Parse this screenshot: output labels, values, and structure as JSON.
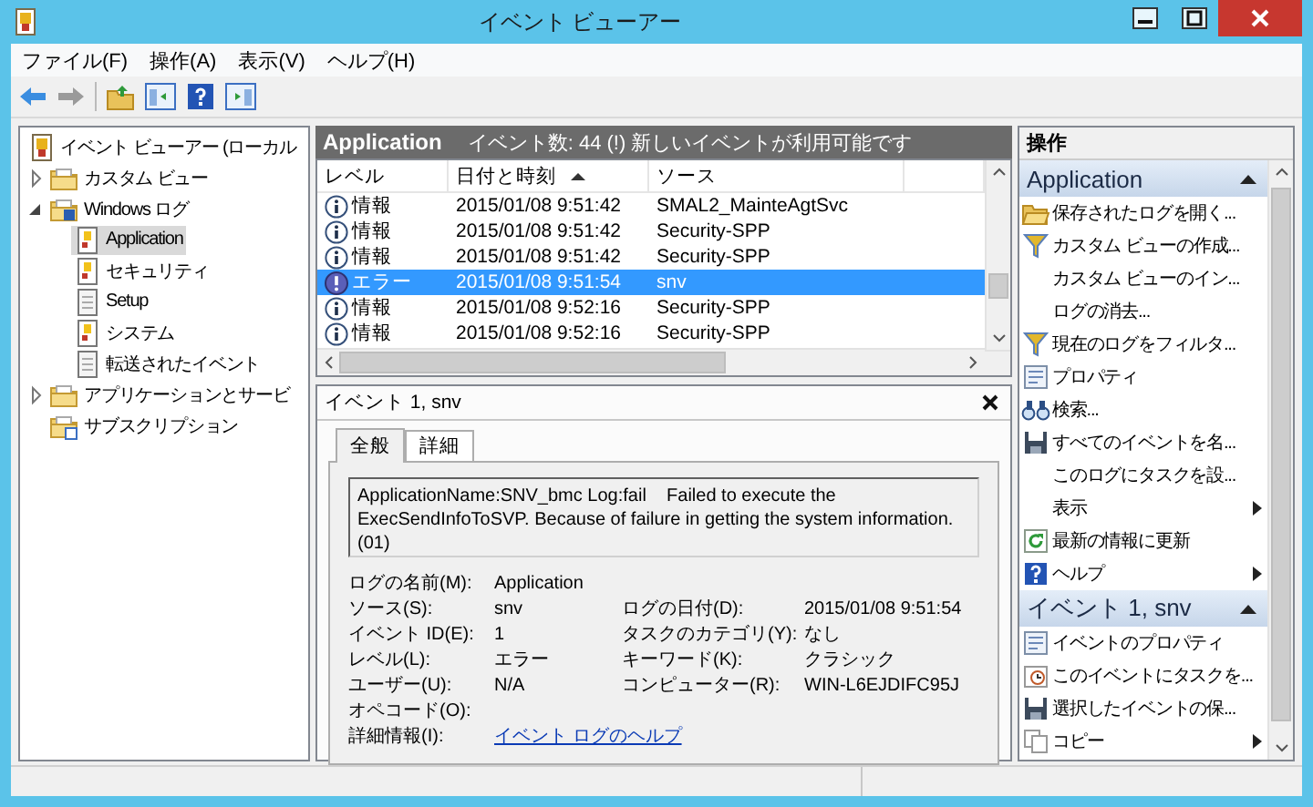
{
  "window": {
    "title": "イベント ビューアー"
  },
  "menu": [
    "ファイル(F)",
    "操作(A)",
    "表示(V)",
    "ヘルプ(H)"
  ],
  "tree": [
    {
      "label": "イベント ビューアー (ローカル",
      "kind": "root",
      "selected": false,
      "children": [
        {
          "label": "カスタム ビュー",
          "kind": "folder",
          "expanded": false,
          "selected": false
        },
        {
          "label": "Windows ログ",
          "kind": "logfolder",
          "expanded": true,
          "selected": false,
          "children": [
            {
              "label": "Application",
              "kind": "log",
              "selected": true
            },
            {
              "label": "セキュリティ",
              "kind": "log",
              "selected": false
            },
            {
              "label": "Setup",
              "kind": "doc",
              "selected": false
            },
            {
              "label": "システム",
              "kind": "log",
              "selected": false
            },
            {
              "label": "転送されたイベント",
              "kind": "doc",
              "selected": false
            }
          ]
        },
        {
          "label": "アプリケーションとサービ",
          "kind": "folder",
          "expanded": false,
          "selected": false
        },
        {
          "label": "サブスクリプション",
          "kind": "subscription",
          "selected": false
        }
      ]
    }
  ],
  "log_header": {
    "title": "Application",
    "summary": "イベント数: 44 (!) 新しいイベントが利用可能です"
  },
  "events": {
    "columns": [
      {
        "label": "レベル",
        "sorted": false
      },
      {
        "label": "日付と時刻",
        "sorted": true
      },
      {
        "label": "ソース",
        "sorted": false
      }
    ],
    "rows": [
      {
        "kind": "info",
        "level": "情報",
        "date": "2015/01/08 9:51:42",
        "source": "SMAL2_MainteAgtSvc",
        "selected": false
      },
      {
        "kind": "info",
        "level": "情報",
        "date": "2015/01/08 9:51:42",
        "source": "Security-SPP",
        "selected": false
      },
      {
        "kind": "info",
        "level": "情報",
        "date": "2015/01/08 9:51:42",
        "source": "Security-SPP",
        "selected": false
      },
      {
        "kind": "error",
        "level": "エラー",
        "date": "2015/01/08 9:51:54",
        "source": "snv",
        "selected": true
      },
      {
        "kind": "info",
        "level": "情報",
        "date": "2015/01/08 9:52:16",
        "source": "Security-SPP",
        "selected": false
      },
      {
        "kind": "info",
        "level": "情報",
        "date": "2015/01/08 9:52:16",
        "source": "Security-SPP",
        "selected": false
      }
    ]
  },
  "detail": {
    "title": "イベント 1, snv",
    "tabs": [
      {
        "label": "全般",
        "selected": true
      },
      {
        "label": "詳細",
        "selected": false
      }
    ],
    "message": "ApplicationName:SNV_bmc Log:fail    Failed to execute the ExecSendInfoToSVP. Because of failure in getting the system information.(01)",
    "rows": [
      [
        {
          "label": "ログの名前(M):",
          "value": "Application"
        }
      ],
      [
        {
          "label": "ソース(S):",
          "value": "snv"
        },
        {
          "label": "ログの日付(D):",
          "value": "2015/01/08 9:51:54"
        }
      ],
      [
        {
          "label": "イベント ID(E):",
          "value": "1"
        },
        {
          "label": "タスクのカテゴリ(Y):",
          "value": "なし"
        }
      ],
      [
        {
          "label": "レベル(L):",
          "value": "エラー"
        },
        {
          "label": "キーワード(K):",
          "value": "クラシック"
        }
      ],
      [
        {
          "label": "ユーザー(U):",
          "value": "N/A"
        },
        {
          "label": "コンピューター(R):",
          "value": "WIN-L6EJDIFC95J"
        }
      ],
      [
        {
          "label": "オペコード(O):"
        }
      ],
      [
        {
          "label": "詳細情報(I):",
          "link": "イベント ログのヘルプ"
        }
      ]
    ]
  },
  "actions": {
    "title": "操作",
    "sections": [
      {
        "title": "Application",
        "expanded": true,
        "items": [
          {
            "label": "保存されたログを開く...",
            "kind": "open",
            "submenu": false
          },
          {
            "label": "カスタム ビューの作成...",
            "kind": "filter",
            "submenu": false
          },
          {
            "label": "カスタム ビューのイン...",
            "kind": "none",
            "submenu": false
          },
          {
            "label": "ログの消去...",
            "kind": "none",
            "submenu": false
          },
          {
            "label": "現在のログをフィルタ...",
            "kind": "filter",
            "submenu": false
          },
          {
            "label": "プロパティ",
            "kind": "properties",
            "submenu": false
          },
          {
            "label": "検索...",
            "kind": "find",
            "submenu": false
          },
          {
            "label": "すべてのイベントを名...",
            "kind": "save",
            "submenu": false
          },
          {
            "label": "このログにタスクを設...",
            "kind": "none",
            "submenu": false
          },
          {
            "label": "表示",
            "kind": "none",
            "submenu": true
          },
          {
            "label": "最新の情報に更新",
            "kind": "refresh",
            "submenu": false
          },
          {
            "label": "ヘルプ",
            "kind": "help",
            "submenu": true
          }
        ]
      },
      {
        "title": "イベント 1, snv",
        "expanded": true,
        "items": [
          {
            "label": "イベントのプロパティ",
            "kind": "properties",
            "submenu": false
          },
          {
            "label": "このイベントにタスクを...",
            "kind": "task",
            "submenu": false
          },
          {
            "label": "選択したイベントの保...",
            "kind": "save",
            "submenu": false
          },
          {
            "label": "コピー",
            "kind": "copy",
            "submenu": true
          }
        ]
      }
    ]
  }
}
